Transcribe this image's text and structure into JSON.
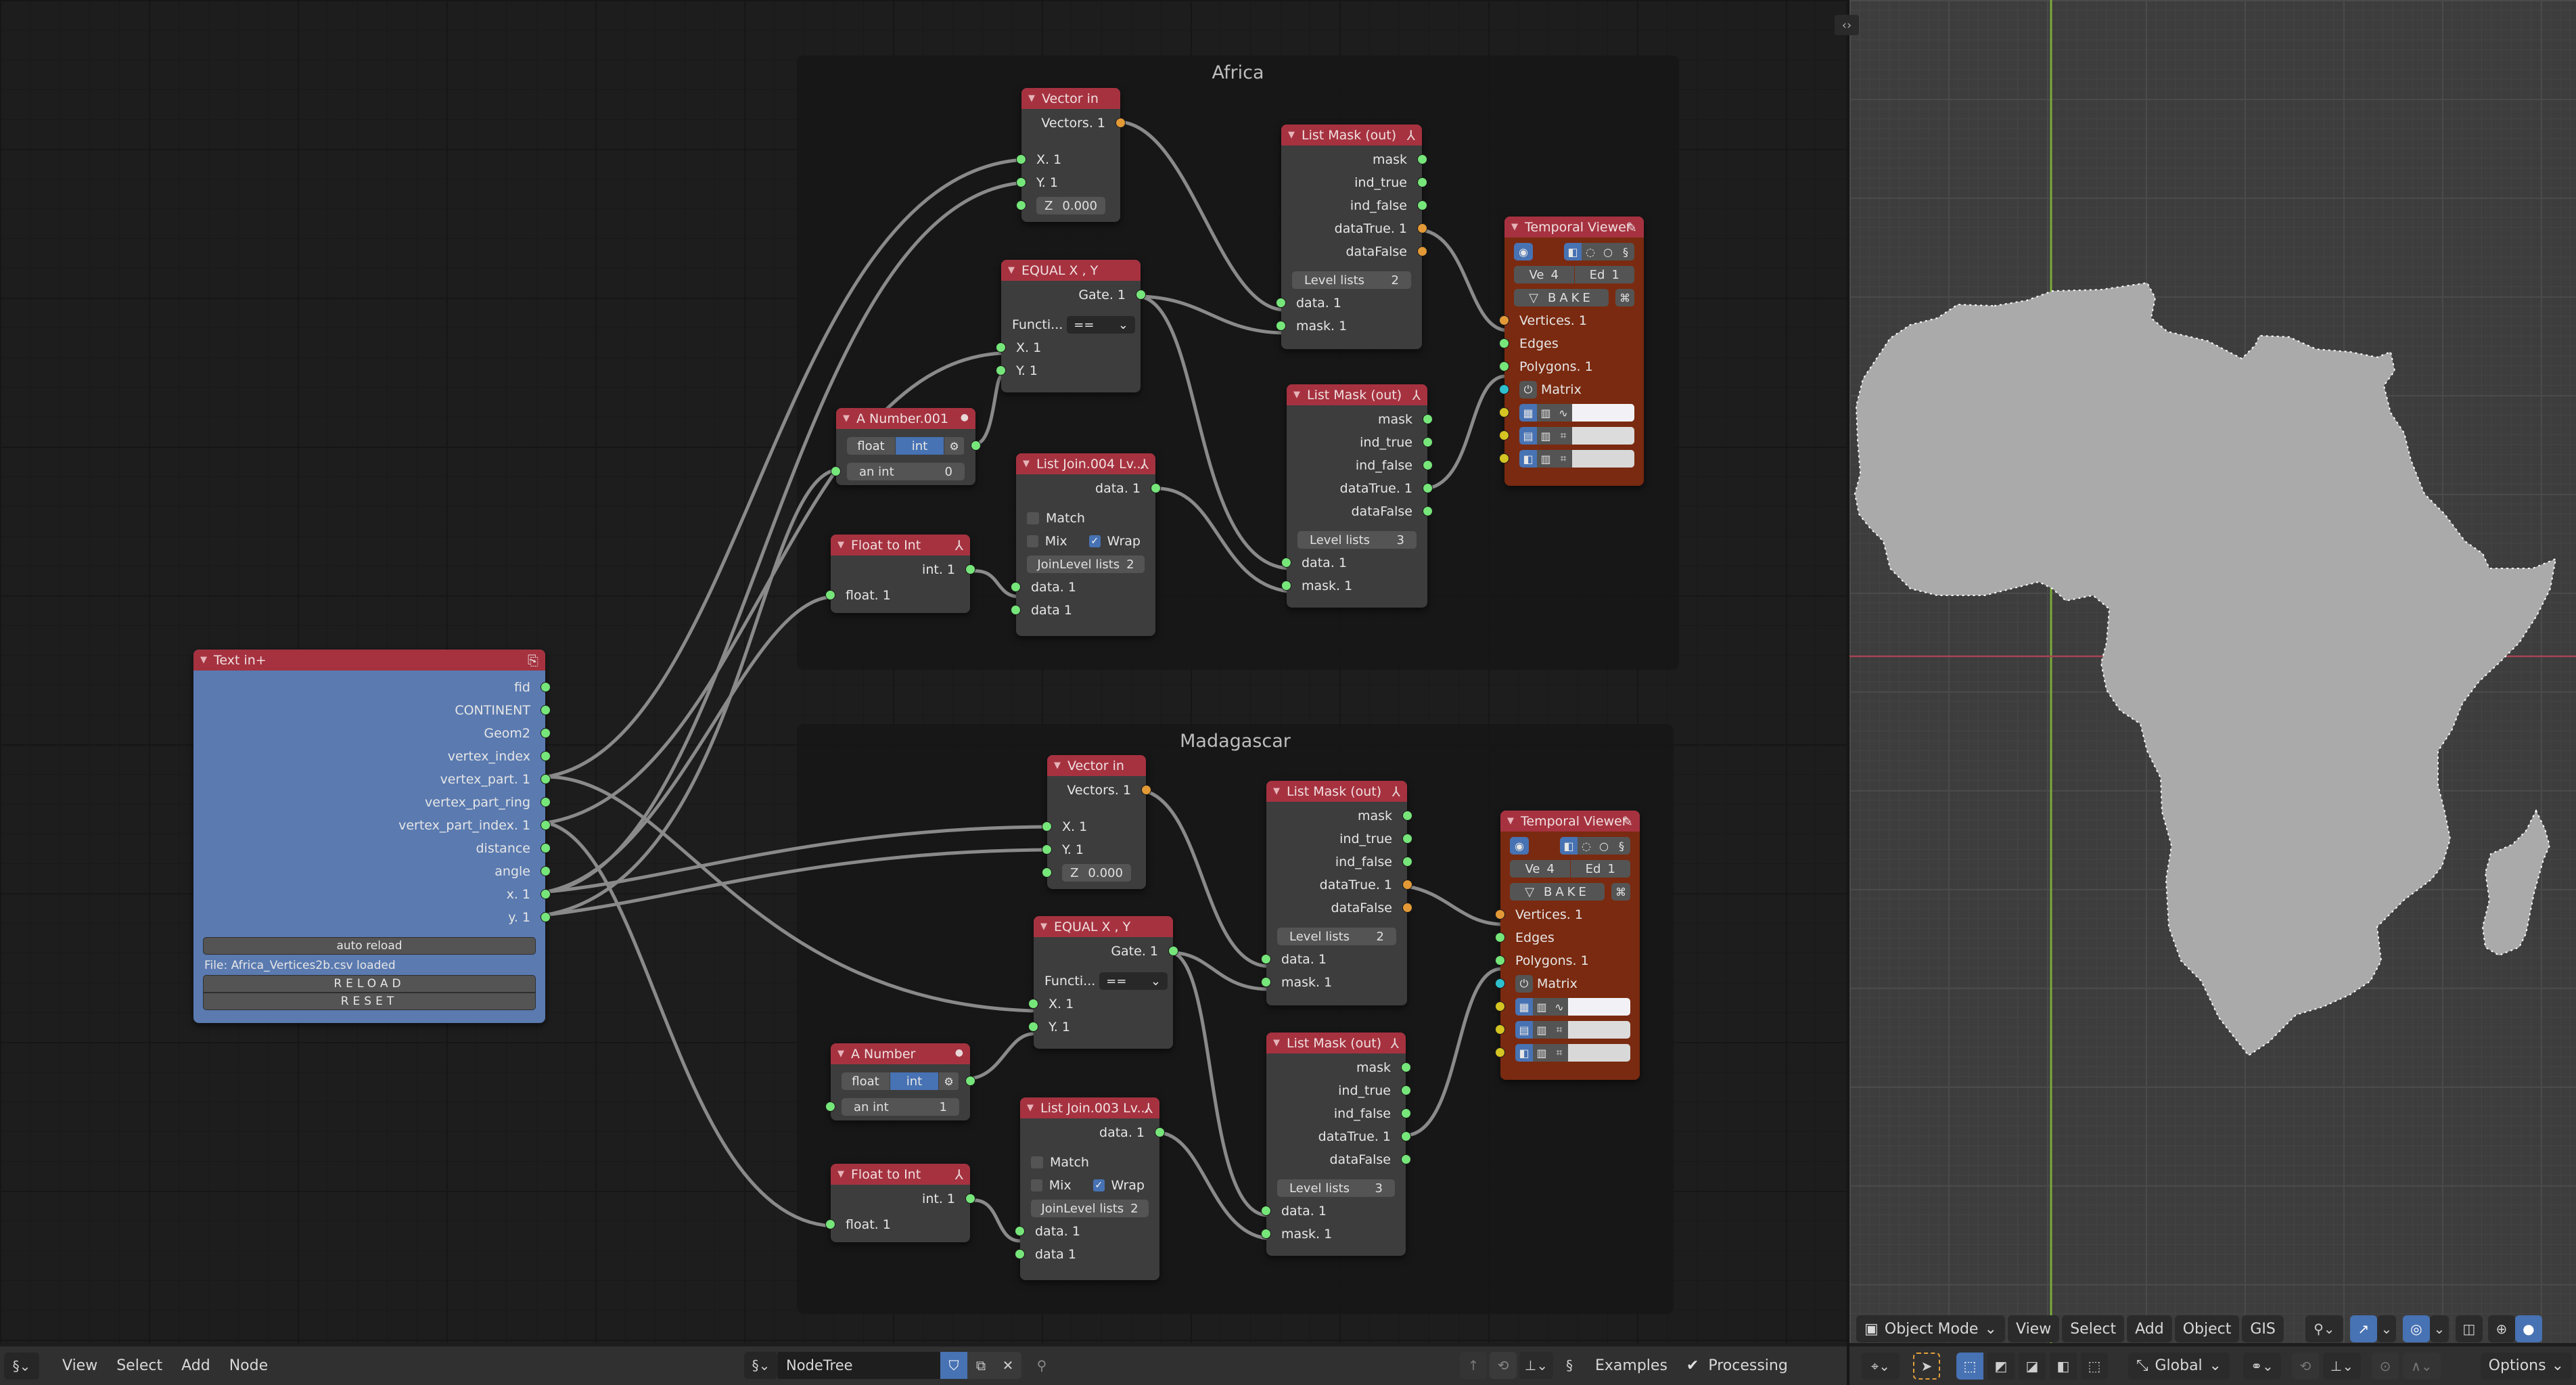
{
  "node_editor": {
    "frames": [
      {
        "label": "Africa"
      },
      {
        "label": "Madagascar"
      }
    ],
    "text_in": {
      "title": "Text in+",
      "outputs": [
        "fid",
        "CONTINENT",
        "Geom2",
        "vertex_index",
        "vertex_part. 1",
        "vertex_part_ring",
        "vertex_part_index. 1",
        "distance",
        "angle",
        "x. 1",
        "y. 1"
      ],
      "auto_reload_label": "auto reload",
      "status": "File: Africa_Vertices2b.csv loaded",
      "reload_label": "RELOAD",
      "reset_label": "RESET"
    },
    "africa": {
      "vector_in": {
        "title": "Vector in",
        "output": "Vectors. 1",
        "x": "X. 1",
        "y": "Y. 1",
        "z_label": "Z",
        "z_value": "0.000"
      },
      "equal": {
        "title": "EQUAL X ,  Y",
        "output": "Gate. 1",
        "function_label": "Functi...",
        "function_value": "==",
        "x": "X. 1",
        "y": "Y. 1"
      },
      "number": {
        "title": "A Number.001",
        "float_label": "float",
        "int_label": "int",
        "field_label": "an int",
        "field_value": "0"
      },
      "float_to_int": {
        "title": "Float to Int",
        "output": "int. 1",
        "input": "float. 1"
      },
      "list_join": {
        "title": "List Join.004 Lv...",
        "output": "data. 1",
        "match_label": "Match",
        "mix_label": "Mix",
        "wrap_label": "Wrap",
        "wrap_checked": true,
        "join_level_label": "JoinLevel lists",
        "join_level_value": "2",
        "input1": "data. 1",
        "input2": "data 1"
      },
      "mask_top": {
        "title": "List Mask (out)",
        "outputs": [
          "mask",
          "ind_true",
          "ind_false",
          "dataTrue. 1",
          "dataFalse"
        ],
        "level_label": "Level lists",
        "level_value": "2",
        "inputs": [
          "data. 1",
          "mask. 1"
        ]
      },
      "mask_bottom": {
        "title": "List Mask (out)",
        "outputs": [
          "mask",
          "ind_true",
          "ind_false",
          "dataTrue. 1",
          "dataFalse"
        ],
        "level_label": "Level lists",
        "level_value": "3",
        "inputs": [
          "data. 1",
          "mask. 1"
        ]
      },
      "viewer": {
        "title": "Temporal Viewer",
        "ve_label": "Ve",
        "ve_value": "4",
        "ed_label": "Ed",
        "ed_value": "1",
        "bake_label": "BAKE",
        "inputs": [
          "Vertices. 1",
          "Edges",
          "Polygons. 1",
          "Matrix"
        ]
      }
    },
    "madagascar": {
      "vector_in": {
        "title": "Vector in",
        "output": "Vectors. 1",
        "x": "X. 1",
        "y": "Y. 1",
        "z_label": "Z",
        "z_value": "0.000"
      },
      "equal": {
        "title": "EQUAL X ,  Y",
        "output": "Gate. 1",
        "function_label": "Functi...",
        "function_value": "==",
        "x": "X. 1",
        "y": "Y. 1"
      },
      "number": {
        "title": "A Number",
        "float_label": "float",
        "int_label": "int",
        "field_label": "an int",
        "field_value": "1"
      },
      "float_to_int": {
        "title": "Float to Int",
        "output": "int. 1",
        "input": "float. 1"
      },
      "list_join": {
        "title": "List Join.003 Lv...",
        "output": "data. 1",
        "match_label": "Match",
        "mix_label": "Mix",
        "wrap_label": "Wrap",
        "wrap_checked": true,
        "join_level_label": "JoinLevel lists",
        "join_level_value": "2",
        "input1": "data. 1",
        "input2": "data 1"
      },
      "mask_top": {
        "title": "List Mask (out)",
        "outputs": [
          "mask",
          "ind_true",
          "ind_false",
          "dataTrue. 1",
          "dataFalse"
        ],
        "level_label": "Level lists",
        "level_value": "2",
        "inputs": [
          "data. 1",
          "mask. 1"
        ]
      },
      "mask_bottom": {
        "title": "List Mask (out)",
        "outputs": [
          "mask",
          "ind_true",
          "ind_false",
          "dataTrue. 1",
          "dataFalse"
        ],
        "level_label": "Level lists",
        "level_value": "3",
        "inputs": [
          "data. 1",
          "mask. 1"
        ]
      },
      "viewer": {
        "title": "Temporal Viewer",
        "ve_label": "Ve",
        "ve_value": "4",
        "ed_label": "Ed",
        "ed_value": "1",
        "bake_label": "BAKE",
        "inputs": [
          "Vertices. 1",
          "Edges",
          "Polygons. 1",
          "Matrix"
        ]
      }
    }
  },
  "node_header": {
    "menus": [
      "View",
      "Select",
      "Add",
      "Node"
    ],
    "tree_name": "NodeTree",
    "examples_label": "Examples",
    "processing_label": "Processing",
    "processing_checked": true
  },
  "viewport_header": {
    "mode": "Object Mode",
    "menus": [
      "View",
      "Select",
      "Add",
      "Object",
      "GIS"
    ],
    "transform_orientation": "Global",
    "options_label": "Options"
  },
  "colors": {
    "node_header": "#a63240",
    "node_body": "#3d3d3d",
    "text_in_body": "#5a7ab0",
    "viewer_body": "#7a2a10",
    "socket_green": "#76e67a",
    "socket_orange": "#e39a36",
    "accent_blue": "#4772b3",
    "mesh_fill": "#aaaaaa"
  }
}
